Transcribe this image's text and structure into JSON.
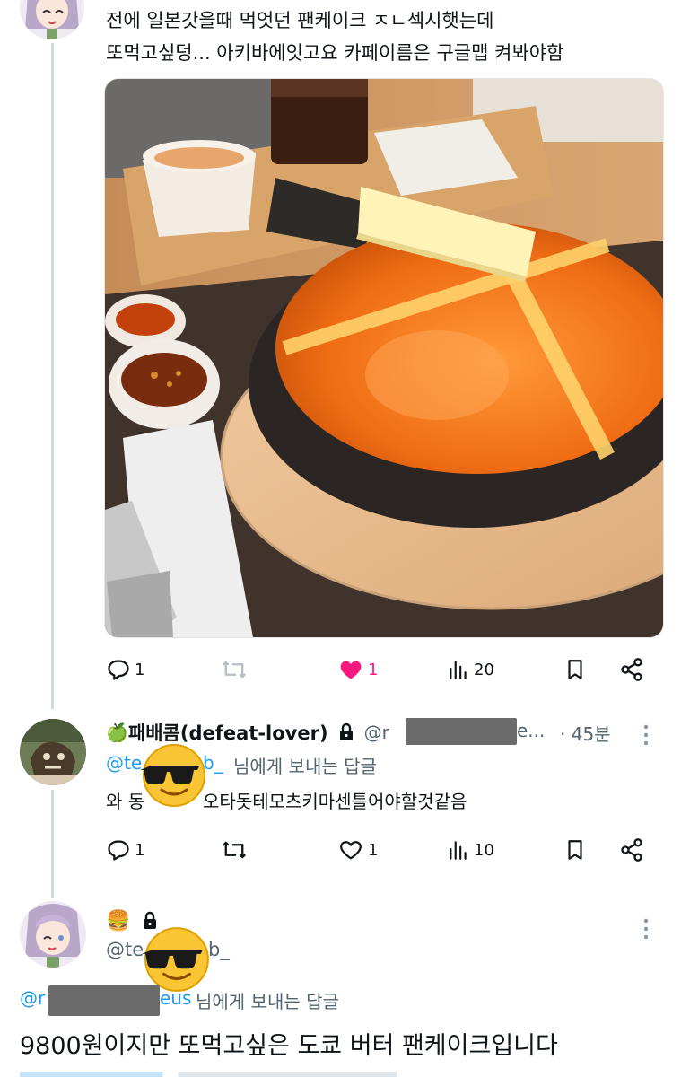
{
  "post1": {
    "text_line1": "전에 일본갓을때 먹엇던 팬케이크 ㅈㄴ섹시햇는데",
    "text_line2": "또먹고싶덩... 아키바에잇고요 카페이름은 구글맵 켜봐야함",
    "actions": {
      "replies": "1",
      "likes": "1",
      "views": "20"
    }
  },
  "post2": {
    "display_name": "패배콤(defeat-lover)",
    "name_emoji": "🍏",
    "handle_visible": "@r",
    "handle_tail": "e...",
    "time": "· 45분",
    "reply_to_handle_start": "@te",
    "reply_to_handle_end": "b_",
    "reply_to_suffix": "님에게 보내는 답글",
    "text_start": "와 동",
    "text_end": "오타돗테모츠키마센틀어야할것같음",
    "actions": {
      "replies": "1",
      "retweets": "",
      "likes": "1",
      "views": "10"
    }
  },
  "post3": {
    "name_emoji": "🍔",
    "handle_start": "@te",
    "handle_end": "b_",
    "reply_to_start": "@r",
    "reply_to_end": "eus",
    "reply_to_suffix": "님에게 보내는 답글",
    "text": "9800원이지만 또먹고싶은 도쿄 버터 팬케이크입니다"
  },
  "colors": {
    "text": "#0f1419",
    "secondary": "#536471",
    "accent": "#1d9bf0",
    "like": "#f91880",
    "line": "#cfd9de"
  }
}
